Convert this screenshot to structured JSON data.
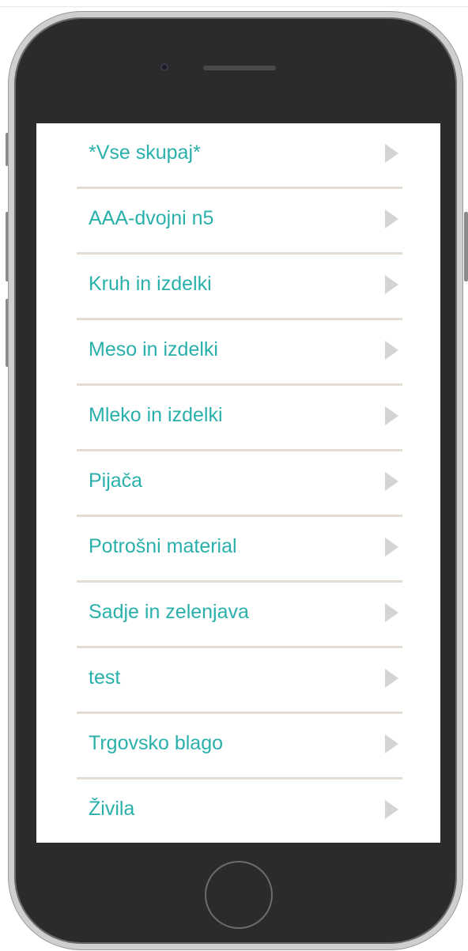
{
  "categories": {
    "items": [
      {
        "label": "*Vse skupaj*"
      },
      {
        "label": "AAA-dvojni n5"
      },
      {
        "label": "Kruh in izdelki"
      },
      {
        "label": "Meso in izdelki"
      },
      {
        "label": "Mleko in izdelki"
      },
      {
        "label": "Pijača"
      },
      {
        "label": "Potrošni material"
      },
      {
        "label": "Sadje in zelenjava"
      },
      {
        "label": "test"
      },
      {
        "label": "Trgovsko blago"
      },
      {
        "label": "Živila"
      }
    ]
  },
  "icons": {
    "item_arrow": "chevron-right-icon",
    "home": "home-button",
    "camera": "front-camera",
    "speaker": "earpiece-speaker"
  },
  "colors": {
    "label": "#2ab0ab",
    "divider": "#e2dcd3",
    "chevron": "#d4d4d4",
    "phone_body": "#2b2b2b"
  }
}
